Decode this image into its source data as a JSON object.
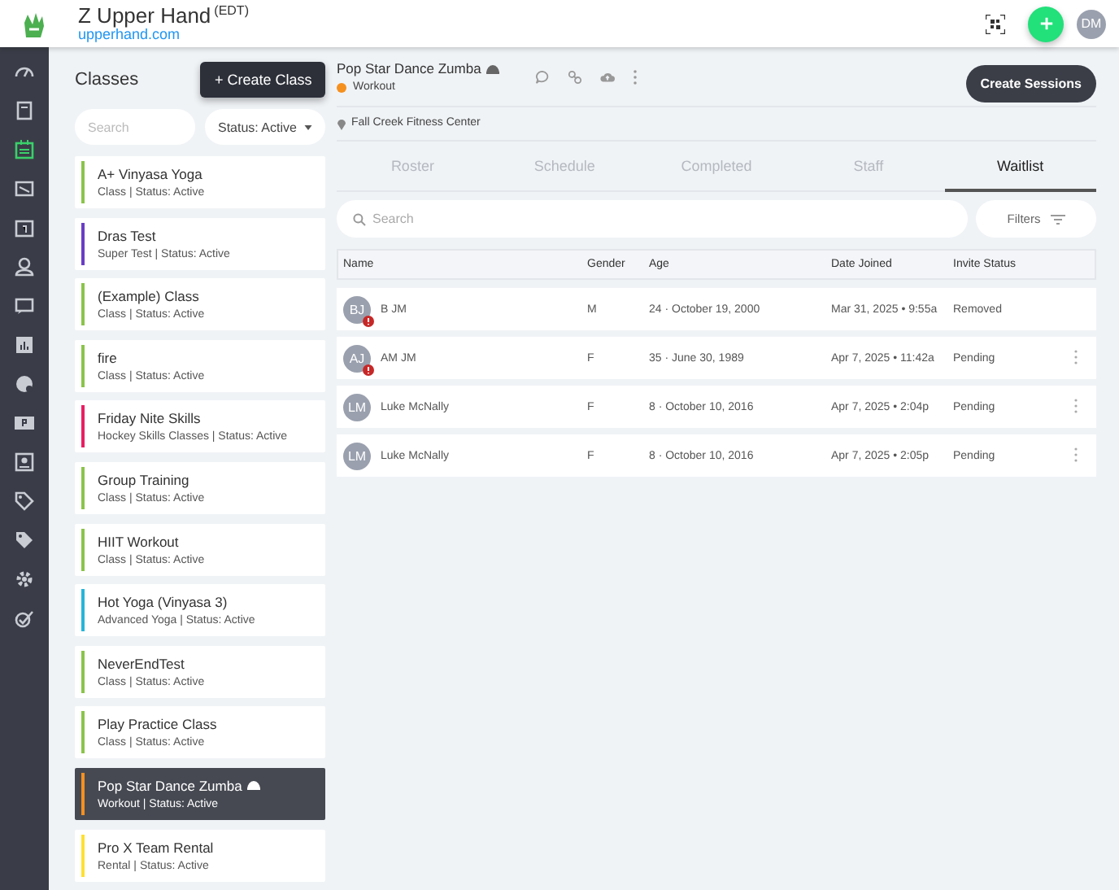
{
  "header": {
    "business": "Z Upper Hand",
    "timezone": "(EDT)",
    "site": "upperhand.com",
    "avatar": "DM"
  },
  "nav": [
    {
      "selected": false
    },
    {
      "selected": false
    },
    {
      "selected": true
    },
    {
      "selected": false
    },
    {
      "selected": false
    },
    {
      "selected": false
    },
    {
      "selected": false
    },
    {
      "selected": false
    },
    {
      "selected": false
    },
    {
      "selected": false
    },
    {
      "selected": false
    },
    {
      "selected": false
    },
    {
      "selected": false
    },
    {
      "selected": false
    },
    {
      "selected": false
    }
  ],
  "classes": {
    "title": "Classes",
    "create_button": "+ Create Class",
    "search": {
      "placeholder": "Search"
    },
    "status_filter": "Status: Active",
    "items": [
      {
        "name": "A+ Vinyasa Yoga",
        "subtitle": "Class | Status: Active",
        "color": "#8bc34a",
        "selected": false
      },
      {
        "name": "Dras Test",
        "subtitle": "Super Test | Status: Active",
        "color": "#6a3dc4",
        "selected": false
      },
      {
        "name": "(Example) Class",
        "subtitle": "Class | Status: Active",
        "color": "#8bc34a",
        "selected": false
      },
      {
        "name": "fire",
        "subtitle": "Class | Status: Active",
        "color": "#8bc34a",
        "selected": false
      },
      {
        "name": "Friday Nite Skills",
        "subtitle": "Hockey Skills Classes | Status: Active",
        "color": "#e91e63",
        "selected": false
      },
      {
        "name": "Group Training",
        "subtitle": "Class | Status: Active",
        "color": "#8bc34a",
        "selected": false
      },
      {
        "name": "HIIT Workout",
        "subtitle": "Class | Status: Active",
        "color": "#8bc34a",
        "selected": false
      },
      {
        "name": "Hot Yoga (Vinyasa 3)",
        "subtitle": "Advanced Yoga | Status: Active",
        "color": "#26b5d9",
        "selected": false
      },
      {
        "name": "NeverEndTest",
        "subtitle": "Class | Status: Active",
        "color": "#8bc34a",
        "selected": false
      },
      {
        "name": "Play Practice Class",
        "subtitle": "Class | Status: Active",
        "color": "#8bc34a",
        "selected": false
      },
      {
        "name": "Pop Star Dance Zumba",
        "subtitle": "Workout | Status: Active",
        "color": "#f5901e",
        "selected": true
      },
      {
        "name": "Pro X Team Rental",
        "subtitle": "Rental | Status: Active",
        "color": "#ffe033",
        "selected": false
      }
    ]
  },
  "detail": {
    "title": "Pop Star Dance Zumba",
    "type": {
      "label": "Workout",
      "color": "#f5901e"
    },
    "location": "Fall Creek Fitness Center",
    "create_sessions": "Create Sessions",
    "tabs": [
      {
        "label": "Roster",
        "selected": false
      },
      {
        "label": "Schedule",
        "selected": false
      },
      {
        "label": "Completed",
        "selected": false
      },
      {
        "label": "Staff",
        "selected": false
      },
      {
        "label": "Waitlist",
        "selected": true
      }
    ],
    "search": {
      "placeholder": "Search"
    },
    "filters": "Filters",
    "table": {
      "columns": [
        "Name",
        "Gender",
        "Age",
        "Date Joined",
        "Invite Status"
      ],
      "rows": [
        {
          "initials": "BJ",
          "alert": true,
          "name": "B JM",
          "gender": "M",
          "age": "24 · October 19, 2000",
          "joined": "Mar 31, 2025 • 9:55a",
          "status": "Removed",
          "menu": false
        },
        {
          "initials": "AJ",
          "alert": true,
          "name": "AM JM",
          "gender": "F",
          "age": "35 · June 30, 1989",
          "joined": "Apr 7, 2025 • 11:42a",
          "status": "Pending",
          "menu": true
        },
        {
          "initials": "LM",
          "alert": false,
          "name": "Luke McNally",
          "gender": "F",
          "age": "8 · October 10, 2016",
          "joined": "Apr 7, 2025 • 2:04p",
          "status": "Pending",
          "menu": true
        },
        {
          "initials": "LM",
          "alert": false,
          "name": "Luke McNally",
          "gender": "F",
          "age": "8 · October 10, 2016",
          "joined": "Apr 7, 2025 • 2:05p",
          "status": "Pending",
          "menu": true
        }
      ]
    }
  }
}
